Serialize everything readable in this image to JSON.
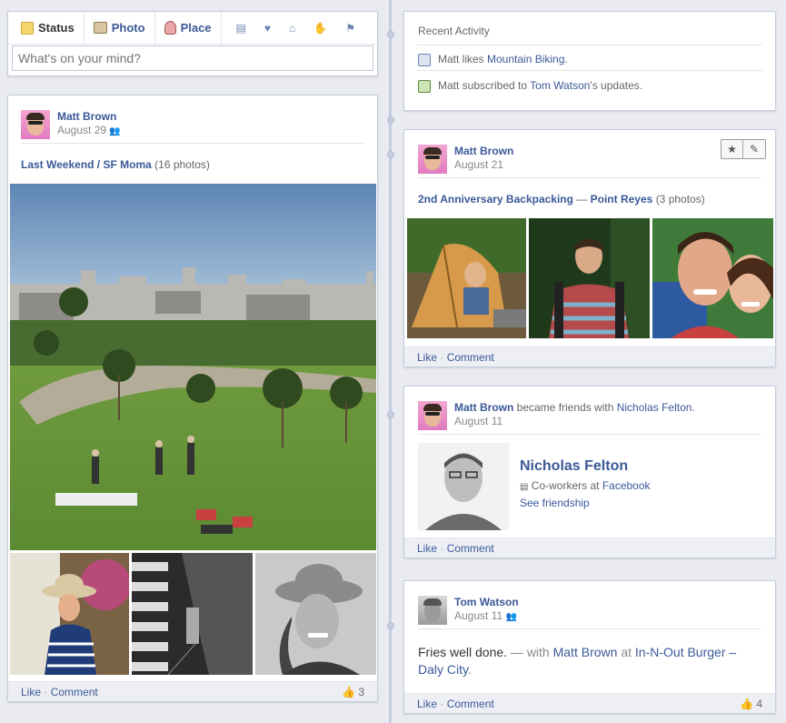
{
  "composer": {
    "tabs": [
      {
        "label": "Status",
        "icon": "status-icon"
      },
      {
        "label": "Photo",
        "icon": "photo-icon"
      },
      {
        "label": "Place",
        "icon": "place-icon"
      }
    ],
    "life_event_icons": [
      "briefcase-icon",
      "heart-icon",
      "home-icon",
      "hand-icon",
      "flag-icon"
    ],
    "input_placeholder": "What's on your mind?"
  },
  "recent_activity": {
    "title": "Recent Activity",
    "items": [
      {
        "prefix": "Matt likes ",
        "link": "Mountain Biking",
        "suffix": "."
      },
      {
        "prefix": "Matt subscribed to ",
        "link": "Tom Watson",
        "suffix": "'s updates."
      }
    ]
  },
  "post_sfmoma": {
    "author": "Matt Brown",
    "date": "August 29",
    "album_link": "Last Weekend / SF Moma",
    "album_count": "(16 photos)",
    "like": "Like",
    "comment": "Comment",
    "likes_count": "3"
  },
  "post_backpacking": {
    "author": "Matt Brown",
    "date": "August 21",
    "album_link": "2nd Anniversary Backpacking",
    "dash": " — ",
    "place_link": "Point Reyes",
    "album_count": "(3 photos)",
    "like": "Like",
    "comment": "Comment"
  },
  "post_friends": {
    "author": "Matt Brown",
    "action": " became friends with ",
    "friend": "Nicholas Felton",
    "date": "August 11",
    "friend_name": "Nicholas Felton",
    "coworkers_prefix": "Co-workers at ",
    "coworkers_link": "Facebook",
    "see_friendship": "See friendship",
    "like": "Like",
    "comment": "Comment"
  },
  "post_tom": {
    "author": "Tom Watson",
    "date": "August 11",
    "text": "Fries well done.",
    "with_text": " — with ",
    "with_link": "Matt Brown",
    "at_text": " at ",
    "place_link": "In-N-Out Burger – Daly City",
    "place_end": ".",
    "like": "Like",
    "comment": "Comment",
    "likes_count": "4"
  },
  "separators": {
    "dot": " · "
  }
}
